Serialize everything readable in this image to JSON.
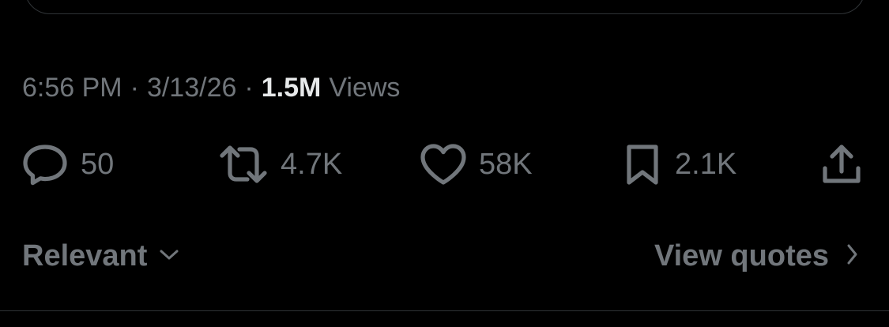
{
  "tweet": {
    "time": "6:56 PM",
    "date": "3/13/26",
    "separator": "·",
    "views_count": "1.5M",
    "views_label": "Views"
  },
  "actions": {
    "reply": {
      "icon": "reply-icon",
      "count": "50"
    },
    "repost": {
      "icon": "repost-icon",
      "count": "4.7K"
    },
    "like": {
      "icon": "heart-icon",
      "count": "58K"
    },
    "bookmark": {
      "icon": "bookmark-icon",
      "count": "2.1K"
    },
    "share": {
      "icon": "share-icon"
    }
  },
  "replies_bar": {
    "sort_label": "Relevant",
    "sort_icon": "chevron-down-icon",
    "view_quotes_label": "View quotes",
    "view_quotes_icon": "chevron-right-icon"
  },
  "colors": {
    "background": "#000000",
    "muted_text": "#71767b",
    "primary_text": "#e7e9ea",
    "border": "#2f3336"
  }
}
